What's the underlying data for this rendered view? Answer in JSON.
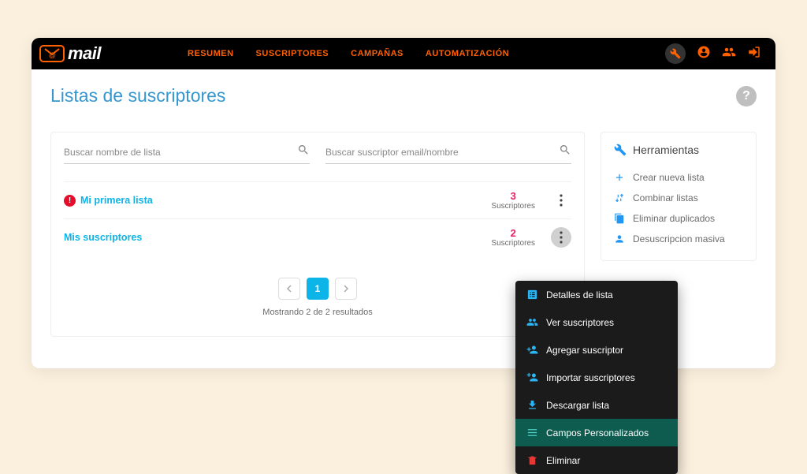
{
  "logo": {
    "text": "mail"
  },
  "nav": {
    "items": [
      "RESUMEN",
      "SUSCRIPTORES",
      "CAMPAÑAS",
      "AUTOMATIZACIÓN"
    ]
  },
  "page": {
    "title": "Listas de suscriptores",
    "help": "?"
  },
  "search": {
    "list_placeholder": "Buscar nombre de lista",
    "sub_placeholder": "Buscar suscriptor email/nombre"
  },
  "lists": [
    {
      "name": "Mi primera lista",
      "count": "3",
      "count_label": "Suscriptores",
      "has_error": true
    },
    {
      "name": "Mis suscriptores",
      "count": "2",
      "count_label": "Suscriptores",
      "has_error": false
    }
  ],
  "pagination": {
    "page": "1",
    "results_text": "Mostrando 2 de 2 resultados"
  },
  "tools": {
    "title": "Herramientas",
    "items": [
      {
        "label": "Crear nueva lista"
      },
      {
        "label": "Combinar listas"
      },
      {
        "label": "Eliminar duplicados"
      },
      {
        "label": "Desuscripcion masiva"
      }
    ]
  },
  "ctx": {
    "items": [
      {
        "label": "Detalles de lista"
      },
      {
        "label": "Ver suscriptores"
      },
      {
        "label": "Agregar suscriptor"
      },
      {
        "label": "Importar suscriptores"
      },
      {
        "label": "Descargar lista"
      },
      {
        "label": "Campos Personalizados"
      },
      {
        "label": "Eliminar"
      }
    ]
  }
}
